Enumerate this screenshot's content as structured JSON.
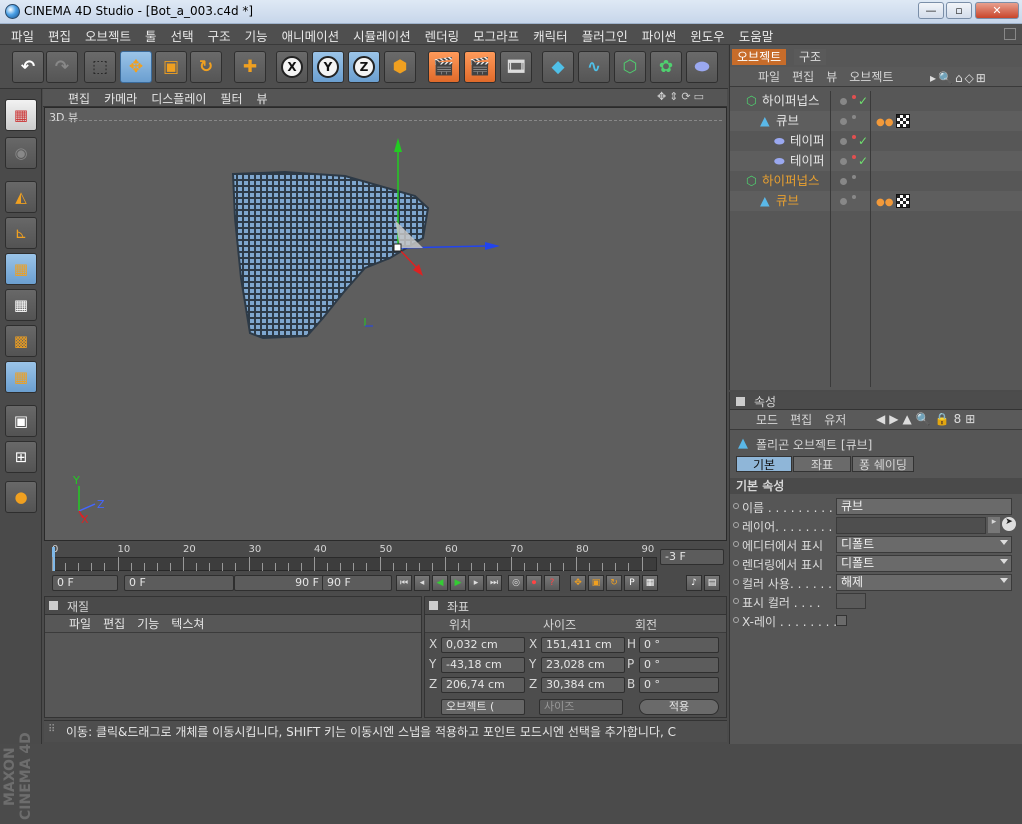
{
  "window": {
    "title": "CINEMA 4D Studio - [Bot_a_003.c4d *]",
    "minimize": "—",
    "maximize": "▫",
    "close": "✕"
  },
  "menubar": [
    "파일",
    "편집",
    "오브젝트",
    "툴",
    "선택",
    "구조",
    "기능",
    "애니메이션",
    "시뮬레이션",
    "렌더링",
    "모그라프",
    "캐릭터",
    "플러그인",
    "파이썬",
    "윈도우",
    "도움말"
  ],
  "viewport": {
    "menu": [
      "편집",
      "카메라",
      "디스플레이",
      "필터",
      "뷰"
    ],
    "label": "3D 뷰",
    "axis_x": "X",
    "axis_y": "Y",
    "axis_z": "Z"
  },
  "timeline": {
    "ticks": [
      "0",
      "10",
      "20",
      "30",
      "40",
      "50",
      "60",
      "70",
      "80",
      "90"
    ],
    "current_frame": "-3 F"
  },
  "timecontrols": {
    "start": "0 F",
    "range_start": "0 F",
    "range_end": "90 F",
    "end": "90 F"
  },
  "material_panel": {
    "title": "재질",
    "menu": [
      "파일",
      "편집",
      "기능",
      "텍스쳐"
    ]
  },
  "coord_panel": {
    "title": "좌표",
    "headers": [
      "위치",
      "사이즈",
      "회전"
    ],
    "rows": [
      {
        "axis": "X",
        "pos": "0,032 cm",
        "size_axis": "X",
        "size": "151,411 cm",
        "rot_axis": "H",
        "rot": "0 °"
      },
      {
        "axis": "Y",
        "pos": "-43,18 cm",
        "size_axis": "Y",
        "size": "23,028 cm",
        "rot_axis": "P",
        "rot": "0 °"
      },
      {
        "axis": "Z",
        "pos": "206,74 cm",
        "size_axis": "Z",
        "size": "30,384 cm",
        "rot_axis": "B",
        "rot": "0 °"
      }
    ],
    "mode_select": "오브젝트 (",
    "size_select": "사이즈",
    "apply": "적용"
  },
  "status": "이동: 클릭&드래그로 개체를 이동시킵니다, SHIFT 키는 이동시엔 스냅을 적용하고 포인트 모드시엔 선택을 추가합니다, C",
  "object_panel": {
    "tabs": [
      "오브젝트",
      "구조"
    ],
    "menu": [
      "파일",
      "편집",
      "뷰",
      "오브젝트"
    ],
    "items": [
      {
        "name": "하이퍼넙스",
        "indent": 0,
        "color": "#e6e6e6",
        "checks": 1
      },
      {
        "name": "큐브",
        "indent": 1,
        "color": "#e6e6e6",
        "checks": 0
      },
      {
        "name": "테이퍼",
        "indent": 2,
        "color": "#e6e6e6",
        "checks": 1
      },
      {
        "name": "테이퍼",
        "indent": 2,
        "color": "#e6e6e6",
        "checks": 1
      },
      {
        "name": "하이퍼넙스",
        "indent": 0,
        "color": "#e8a030",
        "checks": 0
      },
      {
        "name": "큐브",
        "indent": 1,
        "color": "#e8a030",
        "checks": 0
      }
    ]
  },
  "attr_panel": {
    "title": "속성",
    "menu": [
      "모드",
      "편집",
      "유저"
    ],
    "object_title": "폴리곤 오브젝트 [큐브]",
    "tabs": [
      "기본",
      "좌표",
      "퐁 쉐이딩"
    ],
    "section": "기본 속성",
    "fields": [
      {
        "label": "이름 . . . . . . . . . . .",
        "value": "큐브",
        "type": "text"
      },
      {
        "label": "레이어. . . . . . . . .",
        "value": "",
        "type": "layer"
      },
      {
        "label": "에디터에서 표시",
        "value": "디폴트",
        "type": "select"
      },
      {
        "label": "렌더링에서 표시",
        "value": "디폴트",
        "type": "select"
      },
      {
        "label": "컬러 사용. . . . . .",
        "value": "해제",
        "type": "select"
      },
      {
        "label": "표시 컬러 . . . .",
        "value": "",
        "type": "color"
      },
      {
        "label": "X-레이 . . . . . . . .",
        "value": "",
        "type": "check"
      }
    ]
  },
  "brand": "MAXON CINEMA 4D"
}
